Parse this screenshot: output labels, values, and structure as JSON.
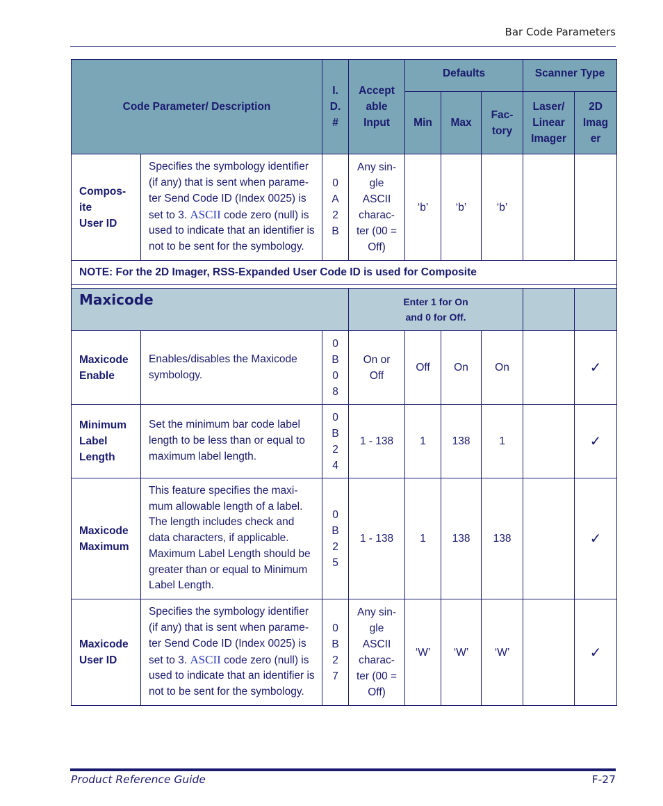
{
  "header": {
    "section_title": "Bar Code Parameters"
  },
  "table": {
    "headers": {
      "code_param": "Code Parameter/ Description",
      "id_lines": [
        "I.",
        "D.",
        "#"
      ],
      "accept_lines": [
        "Accept",
        "able",
        "Input"
      ],
      "defaults": "Defaults",
      "scanner_type": "Scanner Type",
      "min": "Min",
      "max": "Max",
      "factory_lines": [
        "Fac-",
        "tory"
      ],
      "laser_lines": [
        "Laser/",
        "Linear",
        "Imager"
      ],
      "imager_lines": [
        "2D",
        "Imag",
        "er"
      ]
    },
    "rows_top": [
      {
        "label_lines": [
          "Compos-",
          "ite",
          "User ID"
        ],
        "desc_pre": "Specifies the symbology identifier (if any) that is sent when parame-ter Send Code ID (Index 0025) is set to 3. ",
        "desc_ascii": "ASCII",
        "desc_post": " code zero (null) is used to indicate that an identifier is not to be sent for the symbology.",
        "id_lines": [
          "0",
          "A",
          "2",
          "B"
        ],
        "accept_lines": [
          "Any sin-",
          "gle",
          "ASCII",
          "charac-",
          "ter (00 =",
          "Off)"
        ],
        "min": "‘b’",
        "max": "‘b’",
        "factory": "‘b’",
        "laser": "",
        "imager": ""
      }
    ],
    "note": "NOTE: For the 2D Imager, RSS-Expanded User Code ID is used for Composite",
    "section": {
      "title": "Maxicode",
      "hint_lines": [
        "Enter 1 for On",
        "and 0 for Off."
      ]
    },
    "rows": [
      {
        "label_lines": [
          "Maxicode",
          "Enable"
        ],
        "desc": "Enables/disables the Maxicode symbology.",
        "id_lines": [
          "0",
          "B",
          "0",
          "8"
        ],
        "accept_lines": [
          "On or",
          "Off"
        ],
        "min": "Off",
        "max": "On",
        "factory": "On",
        "laser": "",
        "imager": "✓"
      },
      {
        "label_lines": [
          "Minimum",
          "Label",
          "Length"
        ],
        "desc": "Set the minimum bar code label length to be less than or equal to maximum label length.",
        "id_lines": [
          "0",
          "B",
          "2",
          "4"
        ],
        "accept_lines": [
          "1 - 138"
        ],
        "min": "1",
        "max": "138",
        "factory": "1",
        "laser": "",
        "imager": "✓"
      },
      {
        "label_lines": [
          "Maxicode",
          "Maximum"
        ],
        "desc": "This feature specifies the maxi-mum allowable length of a label. The length includes check and data characters, if applicable. Maximum Label Length should be greater than or equal to Minimum Label Length.",
        "id_lines": [
          "0",
          "B",
          "2",
          "5"
        ],
        "accept_lines": [
          "1 - 138"
        ],
        "min": "1",
        "max": "138",
        "factory": "138",
        "laser": "",
        "imager": "✓"
      },
      {
        "label_lines": [
          "Maxicode",
          "User ID"
        ],
        "desc_pre": "Specifies the symbology identifier (if any) that is sent when parame-ter Send Code ID (Index 0025) is set to 3. ",
        "desc_ascii": "ASCII",
        "desc_post": " code zero (null) is used to indicate that an identifier is not to be sent for the symbology.",
        "id_lines": [
          "0",
          "B",
          "2",
          "7"
        ],
        "accept_lines": [
          "Any sin-",
          "gle",
          "ASCII",
          "charac-",
          "ter (00 =",
          "Off)"
        ],
        "min": "‘W’",
        "max": "‘W’",
        "factory": "‘W’",
        "laser": "",
        "imager": "✓"
      }
    ]
  },
  "footer": {
    "guide_title": "Product Reference Guide",
    "page_number": "F-27"
  }
}
